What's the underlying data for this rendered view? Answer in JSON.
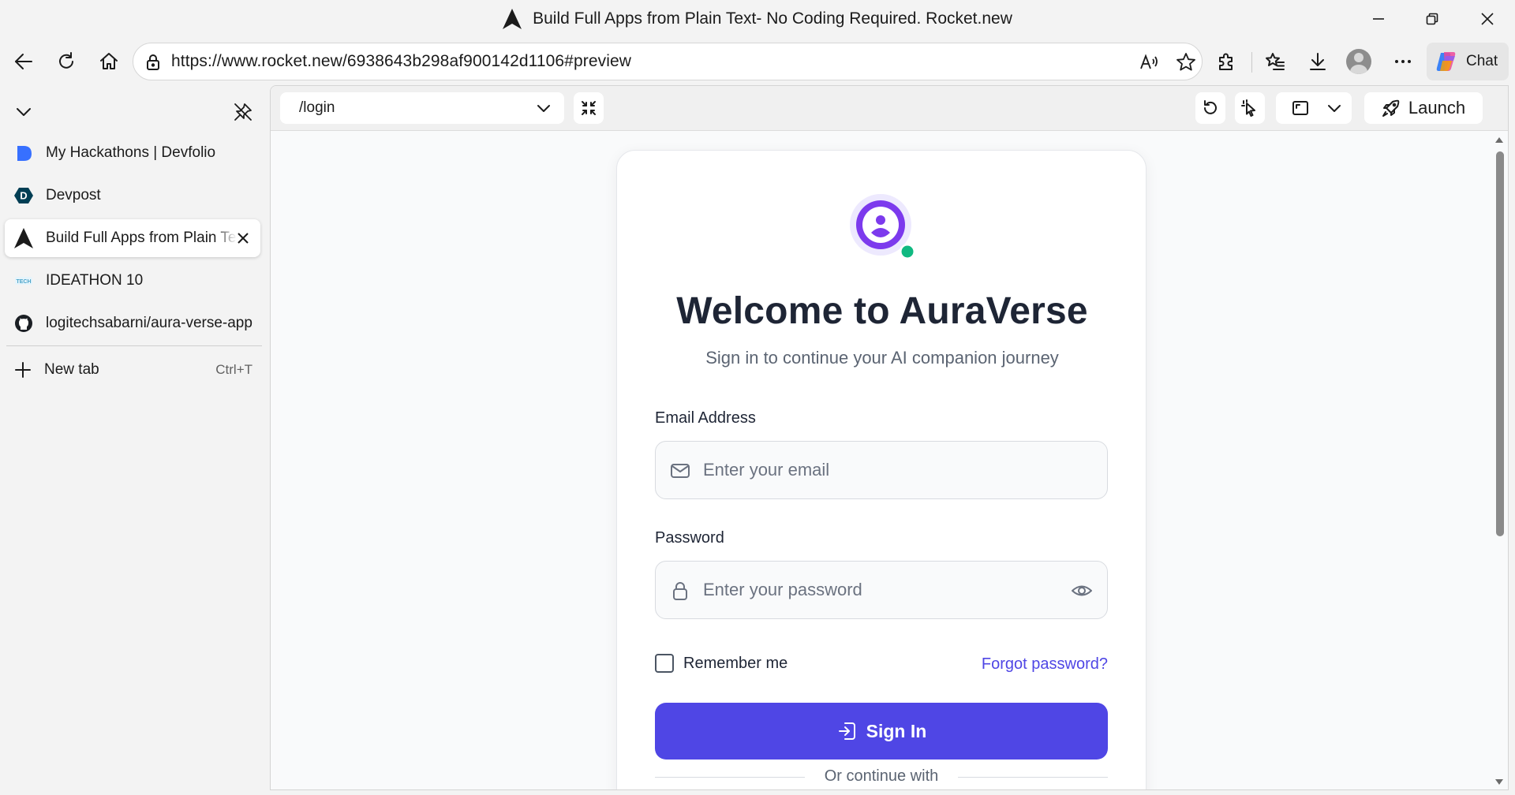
{
  "window": {
    "title": "Build Full Apps from Plain Text- No Coding Required. Rocket.new"
  },
  "address_bar": {
    "url": "https://www.rocket.new/6938643b298af900142d1106#preview"
  },
  "browser": {
    "chat_label": "Chat"
  },
  "sidebar": {
    "tabs": [
      {
        "label": "My Hackathons | Devfolio",
        "icon": "devfolio-icon"
      },
      {
        "label": "Devpost",
        "icon": "devpost-icon"
      },
      {
        "label": "Build Full Apps from Plain Text- No Coding Required. Rocket.new",
        "icon": "rocket-icon",
        "active": true
      },
      {
        "label": "IDEATHON 10",
        "icon": "ideathon-icon"
      },
      {
        "label": "logitechsabarni/aura-verse-app",
        "icon": "github-icon"
      }
    ],
    "new_tab": {
      "label": "New tab",
      "shortcut": "Ctrl+T"
    }
  },
  "preview_toolbar": {
    "route": "/login",
    "launch_label": "Launch"
  },
  "login": {
    "title": "Welcome to AuraVerse",
    "subtitle": "Sign in to continue your AI companion journey",
    "email_label": "Email Address",
    "email_placeholder": "Enter your email",
    "password_label": "Password",
    "password_placeholder": "Enter your password",
    "remember_label": "Remember me",
    "forgot_label": "Forgot password?",
    "signin_label": "Sign In",
    "divider_text": "Or continue with"
  },
  "colors": {
    "accent": "#4f46e5",
    "logo_ring": "#7c3aed",
    "online_dot": "#10b981"
  }
}
